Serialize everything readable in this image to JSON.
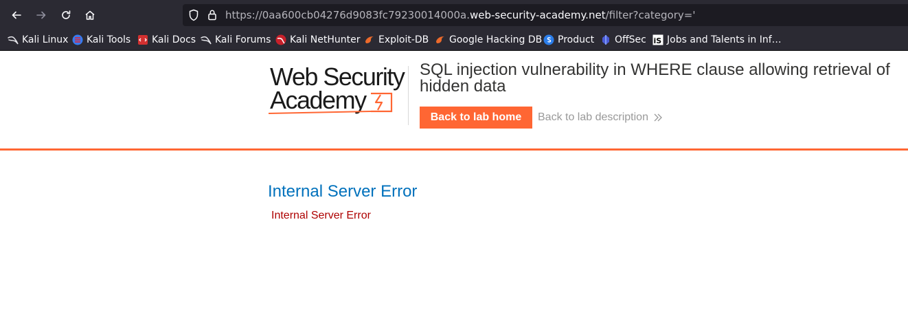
{
  "browser": {
    "url_prefix": "https://0aa600cb04276d9083fc79230014000a.",
    "url_domain": "web-security-academy.net",
    "url_path": "/filter?category='"
  },
  "bookmarks": [
    {
      "label": "Kali Linux",
      "icon": "kali-dragon-icon"
    },
    {
      "label": "Kali Tools",
      "icon": "kali-tools-icon"
    },
    {
      "label": "Kali Docs",
      "icon": "kali-docs-icon"
    },
    {
      "label": "Kali Forums",
      "icon": "kali-dragon-icon"
    },
    {
      "label": "Kali NetHunter",
      "icon": "nethunter-icon"
    },
    {
      "label": "Exploit-DB",
      "icon": "exploit-db-icon"
    },
    {
      "label": "Google Hacking DB",
      "icon": "exploit-db-icon"
    },
    {
      "label": "Product",
      "icon": "product-icon"
    },
    {
      "label": "OffSec",
      "icon": "offsec-icon"
    },
    {
      "label": "Jobs and Talents in Inf…",
      "icon": "is-icon"
    }
  ],
  "header": {
    "logo_line1": "Web Security",
    "logo_line2": "Academy",
    "lab_title": "SQL injection vulnerability in WHERE clause allowing retrieval of hidden data",
    "back_home": "Back to lab home",
    "back_description": "Back to lab description"
  },
  "error": {
    "title": "Internal Server Error",
    "message": "Internal Server Error"
  },
  "colors": {
    "accent": "#ff6633",
    "error_title": "#0071bc",
    "error_message": "#ae0000"
  }
}
